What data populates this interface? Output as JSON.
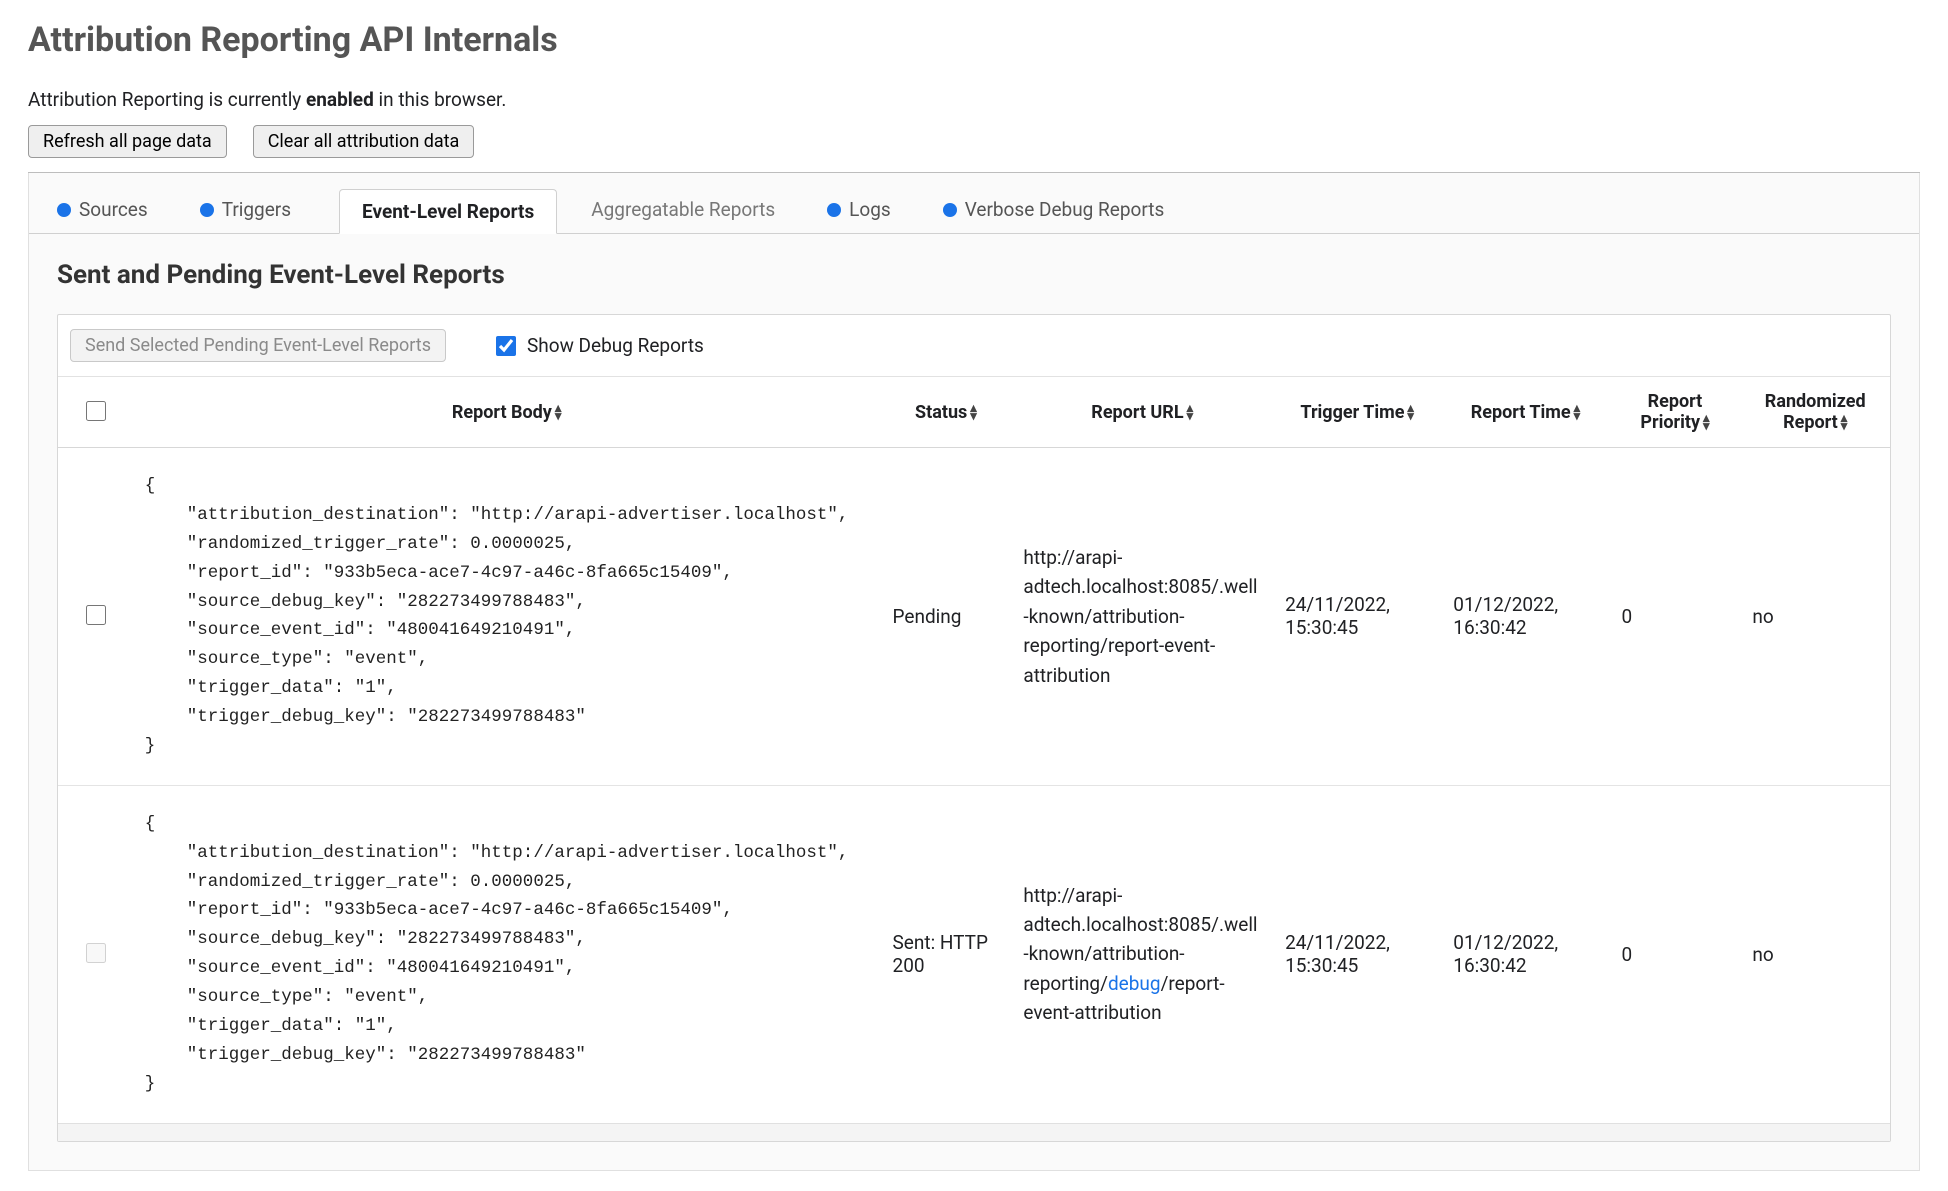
{
  "header": {
    "title": "Attribution Reporting API Internals",
    "status_prefix": "Attribution Reporting is currently ",
    "status_bold": "enabled",
    "status_suffix": " in this browser."
  },
  "buttons": {
    "refresh": "Refresh all page data",
    "clear": "Clear all attribution data"
  },
  "tabs": {
    "sources": "Sources",
    "triggers": "Triggers",
    "event_reports": "Event-Level Reports",
    "aggregatable": "Aggregatable Reports",
    "logs": "Logs",
    "verbose": "Verbose Debug Reports"
  },
  "panel": {
    "heading": "Sent and Pending Event-Level Reports",
    "send_selected": "Send Selected Pending Event-Level Reports",
    "show_debug": "Show Debug Reports"
  },
  "columns": {
    "body": "Report Body",
    "status": "Status",
    "url": "Report URL",
    "trigger_time": "Trigger Time",
    "report_time": "Report Time",
    "priority": "Report Priority",
    "randomized": "Randomized Report"
  },
  "rows": [
    {
      "status": "Pending",
      "url_pre": "http://arapi-adtech.localhost:8085/.well-known/attribution-reporting/report-event-attribution",
      "url_emph": "",
      "url_post": "",
      "trigger_time": "24/11/2022, 15:30:45",
      "report_time": "01/12/2022, 16:30:42",
      "priority": "0",
      "randomized": "no",
      "checkbox_disabled": false,
      "body": "{\n    \"attribution_destination\": \"http://arapi-advertiser.localhost\",\n    \"randomized_trigger_rate\": 0.0000025,\n    \"report_id\": \"933b5eca-ace7-4c97-a46c-8fa665c15409\",\n    \"source_debug_key\": \"282273499788483\",\n    \"source_event_id\": \"480041649210491\",\n    \"source_type\": \"event\",\n    \"trigger_data\": \"1\",\n    \"trigger_debug_key\": \"282273499788483\"\n}"
    },
    {
      "status": "Sent: HTTP 200",
      "url_pre": "http://arapi-adtech.localhost:8085/.well-known/attribution-reporting/",
      "url_emph": "debug",
      "url_post": "/report-event-attribution",
      "trigger_time": "24/11/2022, 15:30:45",
      "report_time": "01/12/2022, 16:30:42",
      "priority": "0",
      "randomized": "no",
      "checkbox_disabled": true,
      "body": "{\n    \"attribution_destination\": \"http://arapi-advertiser.localhost\",\n    \"randomized_trigger_rate\": 0.0000025,\n    \"report_id\": \"933b5eca-ace7-4c97-a46c-8fa665c15409\",\n    \"source_debug_key\": \"282273499788483\",\n    \"source_event_id\": \"480041649210491\",\n    \"source_type\": \"event\",\n    \"trigger_data\": \"1\",\n    \"trigger_debug_key\": \"282273499788483\"\n}"
    }
  ]
}
